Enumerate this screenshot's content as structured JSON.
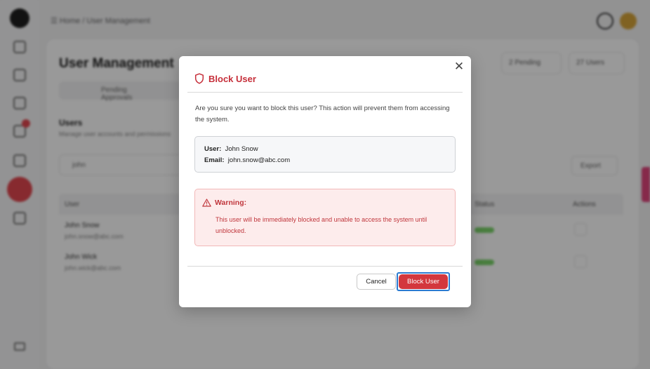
{
  "background": {
    "breadcrumb": "☰ Home / User Management",
    "page_title": "User Management",
    "pending_badge": "2 Pending",
    "users_badge": "27 Users",
    "tab_pending": "Pending Approvals",
    "section_title": "Users",
    "section_subtitle": "Manage user accounts and permissions",
    "search_value": "john",
    "export_label": "Export",
    "columns": [
      "User",
      "Status",
      "Actions"
    ],
    "rows": [
      {
        "name": "John Snow",
        "email": "john.snow@abc.com"
      },
      {
        "name": "John Wick",
        "email": "john.wick@abc.com"
      }
    ]
  },
  "modal": {
    "title": "Block User",
    "close_glyph": "✕",
    "description": "Are you sure you want to block this user? This action will prevent them from accessing the system.",
    "user_label": "User:",
    "user_value": "John Snow",
    "email_label": "Email:",
    "email_value": "john.snow@abc.com",
    "warning_title": "Warning:",
    "warning_text": "This user will be immediately blocked and unable to access the system until unblocked.",
    "cancel_label": "Cancel",
    "confirm_label": "Block User"
  },
  "colors": {
    "accent_red": "#d3373d",
    "title_red": "#c62f3a",
    "warning_bg": "#fdecec",
    "focus_ring": "#2b7bd1"
  },
  "icons": {
    "header": "shield-icon",
    "warning": "warning-triangle-icon",
    "close": "close-icon"
  }
}
